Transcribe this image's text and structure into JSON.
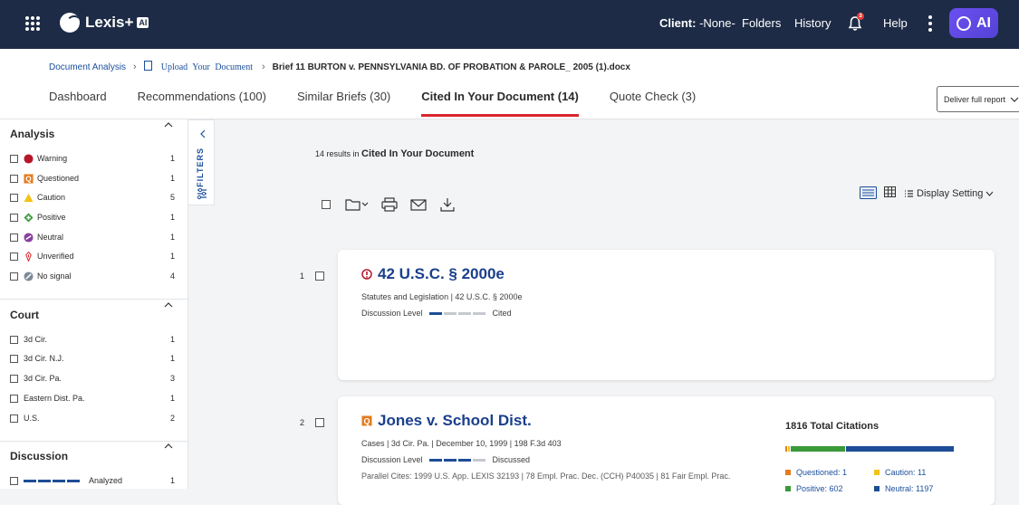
{
  "header": {
    "app_name": "Lexis+",
    "app_badge": "AI",
    "client_label": "Client:",
    "client_value": "-None-",
    "nav": [
      "Folders",
      "History",
      "Help"
    ],
    "notification_count": "3",
    "ai_button_label": "AI",
    "brand_color": "#1d2b46",
    "ai_color": "#5b47e0"
  },
  "breadcrumb": {
    "items": [
      "Document Analysis",
      "Upload Your Document",
      "Brief 11 BURTON v. PENNSYLVANIA BD. OF PROBATION & PAROLE_ 2005 (1).docx"
    ]
  },
  "tabs": [
    {
      "label": "Dashboard"
    },
    {
      "label": "Recommendations  (100)"
    },
    {
      "label": "Similar Briefs  (30)"
    },
    {
      "label": "Cited In Your Document  (14)",
      "active": true
    },
    {
      "label": "Quote Check  (3)"
    }
  ],
  "deliver_button": "Deliver full report",
  "sidebar": {
    "analysis": {
      "title": "Analysis",
      "items": [
        {
          "label": "Warning",
          "count": "1",
          "icon": "warning-signal-icon",
          "color": "#b5162a"
        },
        {
          "label": "Questioned",
          "count": "1",
          "icon": "questioned-signal-icon",
          "color": "#e37c1e"
        },
        {
          "label": "Caution",
          "count": "5",
          "icon": "caution-signal-icon",
          "color": "#f2c318"
        },
        {
          "label": "Positive",
          "count": "1",
          "icon": "positive-signal-icon",
          "color": "#3a9a3a"
        },
        {
          "label": "Neutral",
          "count": "1",
          "icon": "neutral-signal-icon",
          "color": "#8a3fa0"
        },
        {
          "label": "Unverified",
          "count": "1",
          "icon": "unverified-signal-icon",
          "color": "#d8262c"
        },
        {
          "label": "No signal",
          "count": "4",
          "icon": "no-signal-icon",
          "color": "#7d8a99"
        }
      ]
    },
    "court": {
      "title": "Court",
      "items": [
        {
          "label": "3d Cir.",
          "count": "1"
        },
        {
          "label": "3d Cir. N.J.",
          "count": "1"
        },
        {
          "label": "3d Cir. Pa.",
          "count": "3"
        },
        {
          "label": "Eastern Dist. Pa.",
          "count": "1"
        },
        {
          "label": "U.S.",
          "count": "2"
        }
      ]
    },
    "discussion": {
      "title": "Discussion",
      "items": [
        {
          "label": "Analyzed",
          "count": "1",
          "level": 4
        }
      ]
    }
  },
  "filters_label": "FILTERS",
  "results": {
    "count_text": "14 results in",
    "scope": "Cited In Your Document",
    "display_setting": "Display Setting"
  },
  "cards": [
    {
      "index": "1",
      "title": "42 U.S.C. § 2000e",
      "signal": "warning",
      "meta": "Statutes and Legislation  |  42 U.S.C. § 2000e",
      "discussion_label": "Discussion Level",
      "discussion_level": 1,
      "discussion_text": "Cited"
    },
    {
      "index": "2",
      "title": "Jones v. School Dist.",
      "signal": "questioned",
      "meta": "Cases  |  3d Cir. Pa.  |  December 10, 1999  |  198 F.3d 403",
      "discussion_label": "Discussion Level",
      "discussion_level": 3,
      "discussion_text": "Discussed",
      "parallel": "Parallel Cites: 1999 U.S. App. LEXIS 32193   |   78 Empl. Prac. Dec. (CCH) P40035   |   81 Fair Empl. Prac.",
      "citations": {
        "total_label": "1816 Total Citations",
        "questioned": "Questioned: 1",
        "caution": "Caution: 11",
        "positive": "Positive: 602",
        "neutral": "Neutral: 1197",
        "shares": {
          "questioned": 1,
          "caution": 11,
          "positive": 602,
          "neutral": 1197
        }
      }
    }
  ]
}
